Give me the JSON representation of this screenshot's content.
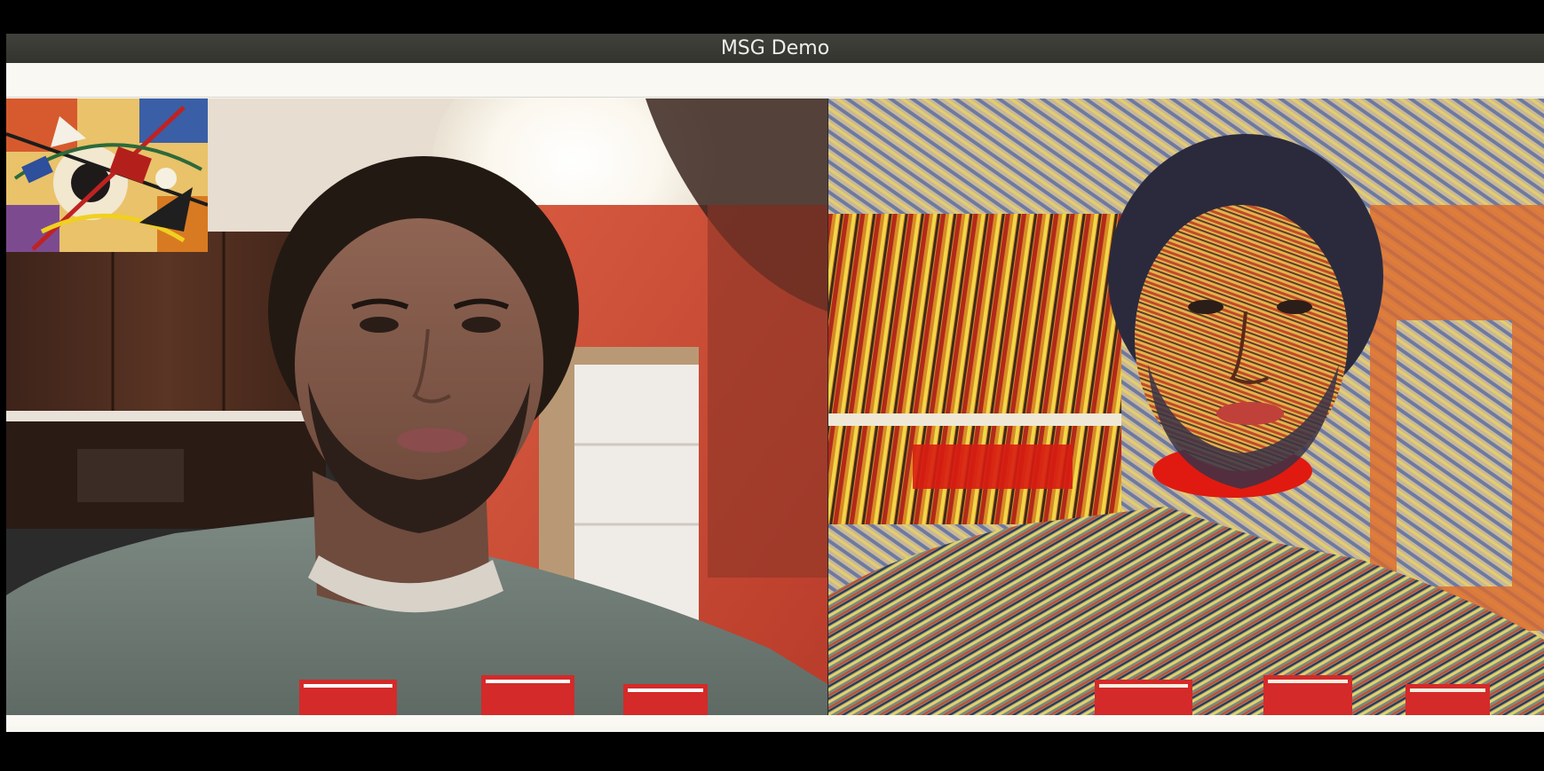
{
  "window": {
    "title": "MSG Demo"
  },
  "panes": {
    "input": {
      "label": "webcam-input-feed",
      "shirt_text": "ΤΛΩ"
    },
    "output": {
      "label": "stylized-output-feed",
      "shirt_text": "ΤΛΩ"
    },
    "style_reference": {
      "label": "style-image-thumbnail"
    }
  },
  "colors": {
    "titlebar": "#3b3b35",
    "title_text": "#eeeeec",
    "window_bg": "#f7f6f1",
    "wall_red": "#c94a35",
    "shirt_gray": "#6f7b74",
    "shirt_letters": "#d42a2a"
  }
}
